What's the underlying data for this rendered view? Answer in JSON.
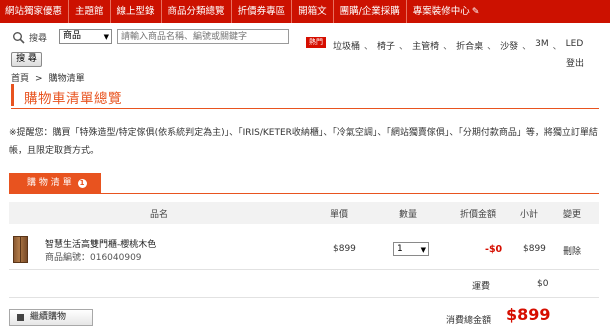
{
  "topnav": {
    "items": [
      "網站獨家優惠",
      "主題館",
      "線上型錄",
      "商品分類總覽",
      "折價券專區",
      "開箱文",
      "團購/企業採購",
      "專案裝修中心"
    ]
  },
  "search": {
    "label": "搜尋",
    "category": "商品",
    "placeholder": "請輸入商品名稱、編號或關鍵字",
    "button": "搜 尋"
  },
  "hot": {
    "badge": "熱門",
    "links": [
      "垃圾桶",
      "椅子",
      "主管椅",
      "折合桌",
      "沙發",
      "3M",
      "LED"
    ]
  },
  "logout": "登出",
  "breadcrumb": {
    "home": "首頁",
    "current": "購物清單"
  },
  "page_title": "購物車清單總覽",
  "notice": "※提醒您：購買「特殊造型/特定傢俱(依系統判定為主)」、「IRIS/KETER收納櫃」、「冷氣空調」、「網站獨賣傢俱」、「分期付款商品」等，將獨立訂單結帳，且限定取貨方式。",
  "tab": {
    "label": "購 物 清 單",
    "badge": "1"
  },
  "table": {
    "headers": {
      "name": "品名",
      "price": "單價",
      "qty": "數量",
      "discount": "折價金額",
      "subtotal": "小計",
      "change": "變更"
    },
    "items": [
      {
        "name": "智慧生活高雙門櫃-櫻桃木色",
        "code": "商品編號：016040909",
        "price": "$899",
        "qty": "1",
        "discount": "-$0",
        "subtotal": "$899",
        "action": "刪除"
      }
    ]
  },
  "shipping": {
    "label": "運費",
    "value": "$0"
  },
  "continue_button": "繼續購物",
  "total": {
    "label": "消費總金額",
    "value": "$899"
  },
  "colors": {
    "nav": "#cc1100",
    "accent": "#e8531f",
    "price_red": "#d60e00"
  }
}
